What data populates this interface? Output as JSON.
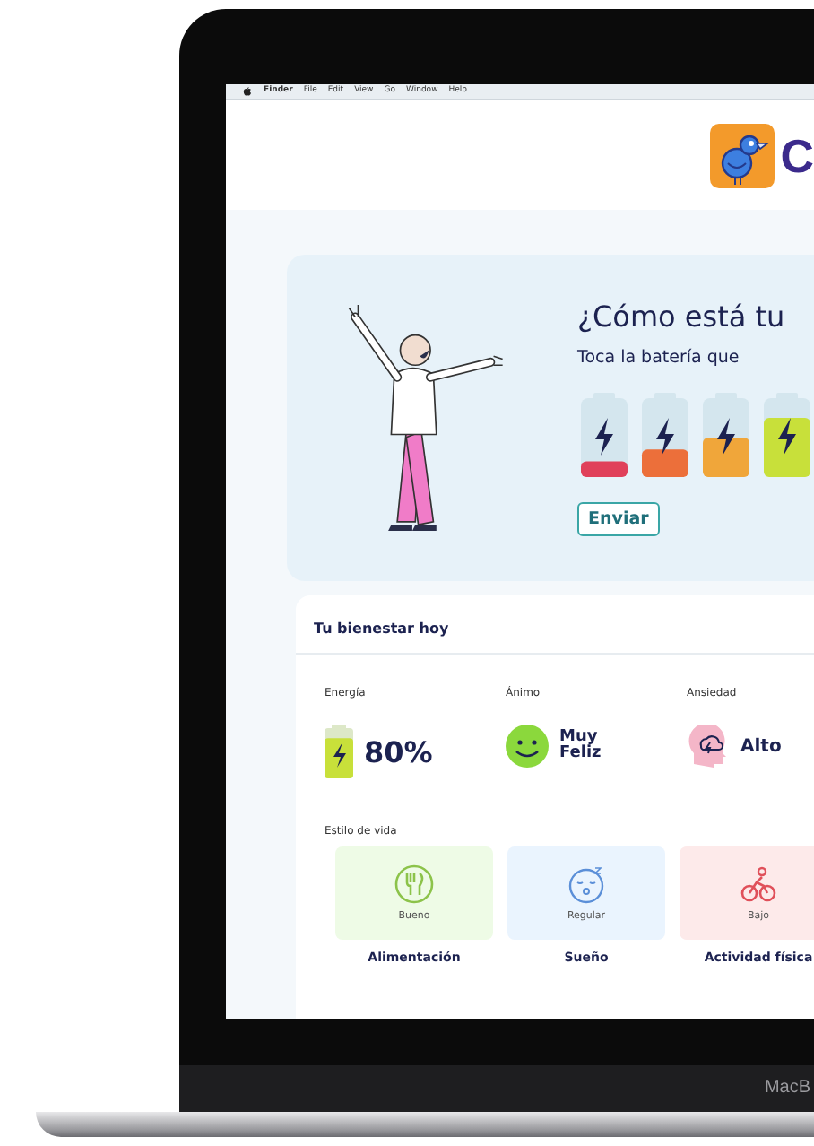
{
  "menu_bar": {
    "items": [
      "Finder",
      "File",
      "Edit",
      "View",
      "Go",
      "Window",
      "Help"
    ]
  },
  "header": {
    "logo_text": "C"
  },
  "checkin": {
    "title": "¿Cómo está tu",
    "subtitle": "Toca la batería que",
    "batteries": [
      {
        "level": 0.2,
        "color": "#e0405a"
      },
      {
        "level": 0.35,
        "color": "#ec6f3a"
      },
      {
        "level": 0.5,
        "color": "#f0a63a"
      },
      {
        "level": 0.75,
        "color": "#c8e03a"
      }
    ],
    "submit": "Enviar"
  },
  "wellbeing": {
    "title": "Tu bienestar hoy",
    "metrics": [
      {
        "kind": "battery",
        "label": "Energía",
        "value": "80%",
        "level": 0.8
      },
      {
        "kind": "mood",
        "label": "Ánimo",
        "value": "Muy Feliz"
      },
      {
        "kind": "anxiety",
        "label": "Ansiedad",
        "value": "Alto"
      }
    ],
    "lifestyle_title": "Estilo de vida",
    "lifestyle": [
      {
        "kind": "food",
        "rating": "Bueno",
        "name": "Alimentación",
        "color": "#eefbe6"
      },
      {
        "kind": "sleep",
        "rating": "Regular",
        "name": "Sueño",
        "color": "#eaf4fe"
      },
      {
        "kind": "bike",
        "rating": "Bajo",
        "name": "Actividad física",
        "color": "#fdeaea"
      }
    ]
  },
  "laptop": {
    "brand_text": "MacB"
  }
}
